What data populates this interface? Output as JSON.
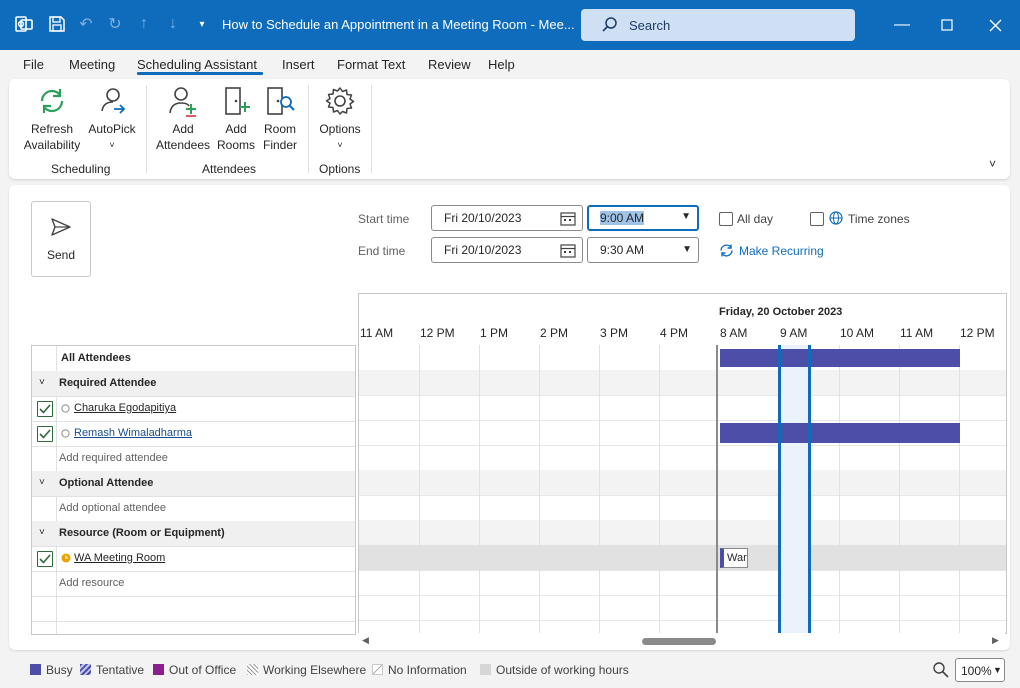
{
  "titlebar": {
    "title": "How to Schedule an Appointment in a Meeting Room  -  Mee...",
    "search_placeholder": "Search"
  },
  "menu": {
    "items": [
      "File",
      "Meeting",
      "Scheduling Assistant",
      "Insert",
      "Format Text",
      "Review",
      "Help"
    ],
    "active": "Scheduling Assistant"
  },
  "ribbon": {
    "refresh_line1": "Refresh",
    "refresh_line2": "Availability",
    "autopick": "AutoPick",
    "group_scheduling": "Scheduling",
    "add_attendees_line1": "Add",
    "add_attendees_line2": "Attendees",
    "add_rooms_line1": "Add",
    "add_rooms_line2": "Rooms",
    "room_finder_line1": "Room",
    "room_finder_line2": "Finder",
    "group_attendees": "Attendees",
    "options": "Options",
    "group_options": "Options"
  },
  "form": {
    "send": "Send",
    "start_time_label": "Start time",
    "end_time_label": "End time",
    "start_date": "Fri 20/10/2023",
    "start_time": "9:00 AM",
    "end_date": "Fri 20/10/2023",
    "end_time": "9:30 AM",
    "all_day": "All day",
    "time_zones": "Time zones",
    "make_recurring": "Make Recurring"
  },
  "grid": {
    "day": "Friday, 20 October 2023",
    "hours_left": [
      "11 AM",
      "12 PM",
      "1 PM",
      "2 PM",
      "3 PM",
      "4 PM"
    ],
    "hours_right": [
      "8 AM",
      "9 AM",
      "10 AM",
      "11 AM",
      "12 PM"
    ],
    "busy_label": "War"
  },
  "attendees": {
    "all": "All Attendees",
    "required_group": "Required Attendee",
    "required": [
      "Charuka Egodapitiya",
      "Remash Wimaladharma"
    ],
    "add_required": "Add required attendee",
    "optional_group": "Optional Attendee",
    "add_optional": "Add optional attendee",
    "resource_group": "Resource (Room or Equipment)",
    "resource": "WA Meeting Room",
    "add_resource": "Add resource"
  },
  "legend": {
    "busy": "Busy",
    "tentative": "Tentative",
    "out_of_office": "Out of Office",
    "working_elsewhere": "Working Elsewhere",
    "no_information": "No Information",
    "outside_hours": "Outside of working hours"
  },
  "zoom": "100%",
  "colors": {
    "accent": "#0f6cbd",
    "busy": "#4d4ea8",
    "out_of_office": "#8b1f8f"
  }
}
